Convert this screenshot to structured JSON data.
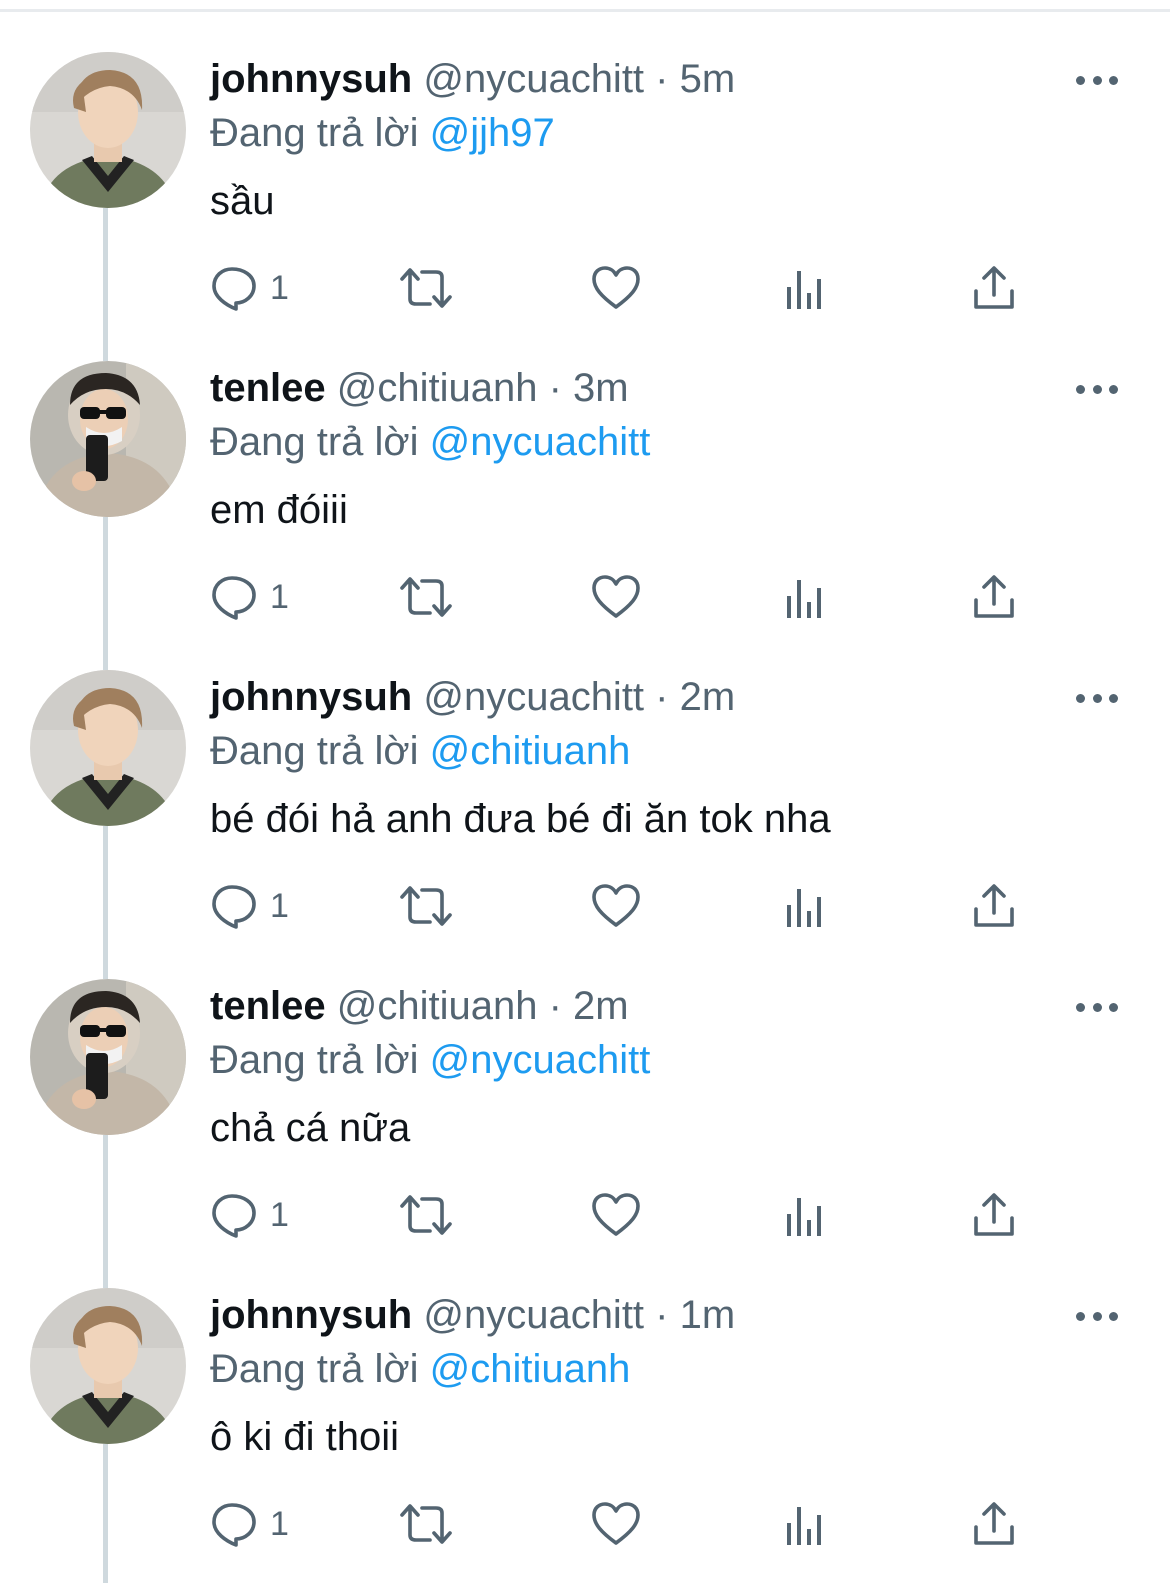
{
  "reply_prefix": "Đang trả lời",
  "tweets": [
    {
      "name": "johnnysuh",
      "handle": "@nycuachitt",
      "separator": "·",
      "time": "5m",
      "reply_to": "@jjh97",
      "text": "sầu",
      "reply_count": "1",
      "avatar": "johnny-avatar"
    },
    {
      "name": "tenlee",
      "handle": "@chitiuanh",
      "separator": "·",
      "time": "3m",
      "reply_to": "@nycuachitt",
      "text": "em đóiii",
      "reply_count": "1",
      "avatar": "ten-avatar"
    },
    {
      "name": "johnnysuh",
      "handle": "@nycuachitt",
      "separator": "·",
      "time": "2m",
      "reply_to": "@chitiuanh",
      "text": "bé đói hả anh đưa bé đi ăn tok nha",
      "reply_count": "1",
      "avatar": "johnny-avatar"
    },
    {
      "name": "tenlee",
      "handle": "@chitiuanh",
      "separator": "·",
      "time": "2m",
      "reply_to": "@nycuachitt",
      "text": "chả cá nữa",
      "reply_count": "1",
      "avatar": "ten-avatar"
    },
    {
      "name": "johnnysuh",
      "handle": "@nycuachitt",
      "separator": "·",
      "time": "1m",
      "reply_to": "@chitiuanh",
      "text": "ô ki đi thoii",
      "reply_count": "1",
      "avatar": "johnny-avatar"
    }
  ],
  "colors": {
    "accent": "#1d9bf0",
    "secondary_text": "#536471",
    "primary_text": "#0f1419",
    "thread_line": "#cfd9de"
  },
  "icons": {
    "reply": "reply-icon",
    "retweet": "retweet-icon",
    "like": "heart-icon",
    "views": "analytics-icon",
    "share": "share-icon",
    "more": "more-icon"
  }
}
